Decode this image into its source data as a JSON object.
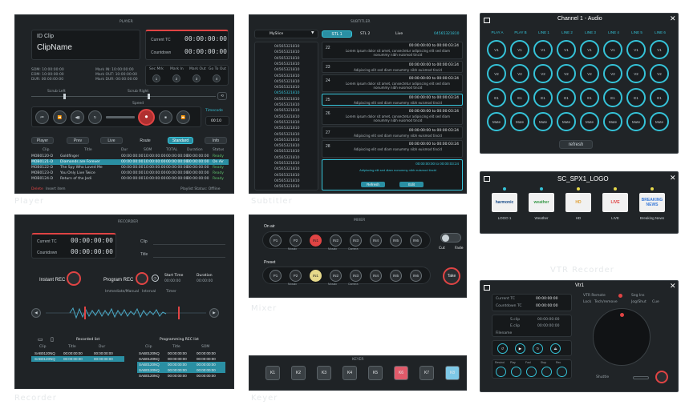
{
  "captions": {
    "player": "Player",
    "subtitler": "Subtitler",
    "recorder": "Recorder",
    "mixer": "Mixer",
    "keyer": "Keyer",
    "vtr": "VTR Recorder"
  },
  "player": {
    "header": "PLAYER",
    "id_label": "ID Clip",
    "clip_name": "ClipName",
    "current_tc_label": "Current TC",
    "current_tc": "00:00:00:00",
    "countdown_label": "Countdown",
    "countdown": "00:00:00:00",
    "meta_left": [
      "SOM: 10:00:00:00",
      "EOM: 10:00:00:00",
      "DUR: 00:00:00:00"
    ],
    "meta_right": [
      "Mark IN: 10:00:00:00",
      "Mark OUT: 10:00:00:00",
      "Mark DUR: 00:00:00:00"
    ],
    "toggles": [
      "Sec Mrk",
      "Mark In",
      "Mark Out",
      "Go To Out"
    ],
    "toggle_values": [
      "1",
      "2",
      "3",
      "4"
    ],
    "scrub_left": "Scrub Left",
    "scrub_right": "Scrub Right",
    "speed_label": "Speed",
    "speed_value": "1.0",
    "loop_label": "Loop",
    "timecode_label": "Timecode",
    "timecode_value": "00:10",
    "tabs": [
      "Player",
      "Prev",
      "Live",
      "Route",
      "Standard",
      "Info"
    ],
    "table_headers": [
      "Clip",
      "Title",
      "Dur",
      "SOM",
      "TOTAL",
      "Duration",
      "Status"
    ],
    "rows": [
      [
        "MOB0120-D",
        "Goldfinger",
        "00:00:00:00",
        "10:00:00:00",
        "00:00:00:00",
        "00:00:00:00",
        "Ready"
      ],
      [
        "MOB0121-D",
        "Diamonds are Forever",
        "00:00:00:00",
        "10:00:00:00",
        "00:00:00:00",
        "00:00:00:00",
        "On Air"
      ],
      [
        "MOB0122-D",
        "The Spy Who Loved Me",
        "00:00:00:00",
        "10:00:00:00",
        "00:00:00:00",
        "00:00:00:00",
        "Ready"
      ],
      [
        "MOB0123-D",
        "You Only Live Twice",
        "00:00:00:00",
        "10:00:00:00",
        "00:00:00:00",
        "00:00:00:00",
        "Ready"
      ],
      [
        "MOB0124-D",
        "Return of the Jedi",
        "00:00:00:00",
        "10:00:00:00",
        "00:00:00:00",
        "00:00:00:00",
        "Ready"
      ]
    ],
    "footer_left": "Delete",
    "footer_left2": "Insert item",
    "footer_right": "Playlist Status: Offline"
  },
  "subtitler": {
    "header": "SUBTITLER",
    "dropdown": "MySlice",
    "stl1": "STL 1",
    "stl2": "STL 2",
    "live": "Live",
    "live_tc": "04565321810",
    "list": [
      "04565321810",
      "04565321810",
      "04565321810",
      "04565321810",
      "04565321810",
      "04565321810",
      "04565321810",
      "04565321810",
      "04565321810",
      "04565321810",
      "04565321810",
      "04565321810",
      "04565321810",
      "04565321810",
      "04565321810",
      "04565321810",
      "04565321810",
      "04565321810",
      "04565321810",
      "04565321810",
      "04565321810",
      "04565321810",
      "04565321810",
      "04565321810",
      "04565321810"
    ],
    "items": [
      {
        "num": "22",
        "tc": "00:00:00:00 to 00:00:03:24",
        "text": "Lorem ipsum dolor sit amet, consectetur adipiscing elit sed diam nonummy nibh euismod tincid"
      },
      {
        "num": "23",
        "tc": "00:00:00:00 to 00:00:03:24",
        "text": "Adipiscing elit sed diam nonummy nibh euismod tincid"
      },
      {
        "num": "24",
        "tc": "00:00:00:00 to 00:00:03:24",
        "text": "Lorem ipsum dolor sit amet, consectetur adipiscing elit sed diam nonummy nibh euismod tincid"
      },
      {
        "num": "25",
        "tc": "00:00:00:00 to 00:00:03:24",
        "text": "Adipiscing elit sed diam nonummy nibh euismod tincid"
      },
      {
        "num": "26",
        "tc": "00:00:00:00 to 00:00:03:24",
        "text": "Lorem ipsum dolor sit amet, consectetur adipiscing elit sed diam nonummy nibh euismod tincid"
      },
      {
        "num": "27",
        "tc": "00:00:00:00 to 00:00:03:24",
        "text": "Adipiscing elit sed diam nonummy nibh euismod tincid"
      },
      {
        "num": "28",
        "tc": "00:00:00:00 to 00:00:03:24",
        "text": "Adipiscing elit sed diam nonummy nibh euismod tincid"
      }
    ],
    "edit_tc": "00:00:00:00 to 00:00:03:24",
    "edit_text": "Adipiscing elit sed diam nonummy nibh euismod tincid",
    "btn_refresh": "Refresh",
    "btn_edit": "Edit"
  },
  "recorder": {
    "header": "RECORDER",
    "current_tc_label": "Current TC",
    "current_tc": "00:00:00:00",
    "countdown_label": "Countdown",
    "countdown": "00:00:00:00",
    "clip_label": "Clip",
    "title_label": "Title",
    "instant_rec": "Instant REC",
    "program_rec": "Program REC",
    "start_time_label": "Start Time",
    "start_time": "00:00:00",
    "duration_label": "Duration",
    "duration": "00:00:00",
    "options": [
      "Immediate/Manual",
      "Interval",
      "Timer"
    ],
    "recorded_list": "Recorded list",
    "programming_list": "Programming REC list",
    "left_headers": [
      "Clip",
      "Title",
      "Dur"
    ],
    "left_rows": [
      [
        "SAB0120NQ",
        "00:00:00:00",
        "00:00:00:00"
      ],
      [
        "SAB0120NQ",
        "00:00:00:00",
        "00:00:00:00"
      ]
    ],
    "right_headers": [
      "Clip",
      "Title",
      "SOM"
    ],
    "right_rows": [
      [
        "SAB0120NQ",
        "00:00:00:00",
        "00:00:00:00"
      ],
      [
        "SAB0120NQ",
        "00:00:00:00",
        "00:00:00:00"
      ],
      [
        "SAB0120NQ",
        "00:00:00:00",
        "00:00:00:00"
      ],
      [
        "SAB0120NQ",
        "00:00:00:00",
        "00:00:00:00"
      ],
      [
        "SAB0120NQ",
        "00:00:00:00",
        "00:00:00:00"
      ]
    ]
  },
  "mixer": {
    "header": "MIXER",
    "on_air_label": "On air",
    "preset_label": "Preset",
    "on_air_buttons": [
      "P1",
      "P2",
      "IN1",
      "IN2",
      "IN3",
      "IN4",
      "IN5",
      "IN6"
    ],
    "preset_buttons": [
      "P1",
      "P2",
      "IN1",
      "IN2",
      "IN3",
      "IN4",
      "IN5",
      "IN6"
    ],
    "sublabels": [
      "",
      "Mosaic",
      "",
      "Mosaic",
      "Camera",
      "",
      "",
      ""
    ],
    "cut": "Cut",
    "fade": "Fade",
    "take": "Take"
  },
  "keyer": {
    "header": "KEYER",
    "keys": [
      "K1",
      "K2",
      "K3",
      "K4",
      "K5",
      "K6",
      "K7",
      "K8"
    ]
  },
  "channel": {
    "title": "Channel 1 - Audio",
    "headers": [
      "PLAY A",
      "PLAY B",
      "LINE 1",
      "LINE 2",
      "LINE 3",
      "LINE 4",
      "LINE 5",
      "LINE 6"
    ],
    "rows": [
      [
        "V1",
        "V1",
        "V1",
        "V1",
        "V1",
        "V1",
        "V1",
        "V1"
      ],
      [
        "V2",
        "V2",
        "V2",
        "V2",
        "V2",
        "V2",
        "V2",
        "V2"
      ],
      [
        "E1",
        "E1",
        "E1",
        "E1",
        "E1",
        "E1",
        "E1",
        "E1"
      ],
      [
        "Mute",
        "Mute",
        "Mute",
        "Mute",
        "Mute",
        "Mute",
        "Mute",
        "Mute"
      ]
    ],
    "refresh": "refresh"
  },
  "logo": {
    "title": "SC_SPX1_LOGO",
    "items": [
      {
        "thumb": "harmonic",
        "label": "LOGO 1"
      },
      {
        "thumb": "weather",
        "label": "Weather"
      },
      {
        "thumb": "HD",
        "label": "HD"
      },
      {
        "thumb": "LIVE",
        "label": "LIVE"
      },
      {
        "thumb": "BREAKING NEWS",
        "label": "Breaking News"
      }
    ]
  },
  "vtr": {
    "title": "Vtr1",
    "current_tc_label": "Current TC",
    "current_tc": "00:00:00:00",
    "countdown_label": "Countdown TC",
    "countdown": "00:00:00:00",
    "sin_label": "S.clip",
    "sin_value": "00:00:00:00",
    "sout_label": "E.clip",
    "sout_value": "00:00:00:00",
    "filename_label": "Filename",
    "opt1": "VTR Remote",
    "opt2": "Seg Ins",
    "opt3": "Lock",
    "opt4": "Tech/remove",
    "opt5": "Jog/Shut",
    "opt6": "Cue",
    "bottom_labels": [
      "Rewind",
      "Play",
      "Fwd",
      "Stop",
      "Rec"
    ],
    "shuttle": "Shuttle"
  },
  "colors": {
    "accent": "#35c3d8",
    "red": "#e04444",
    "panel": "#1f2326"
  }
}
